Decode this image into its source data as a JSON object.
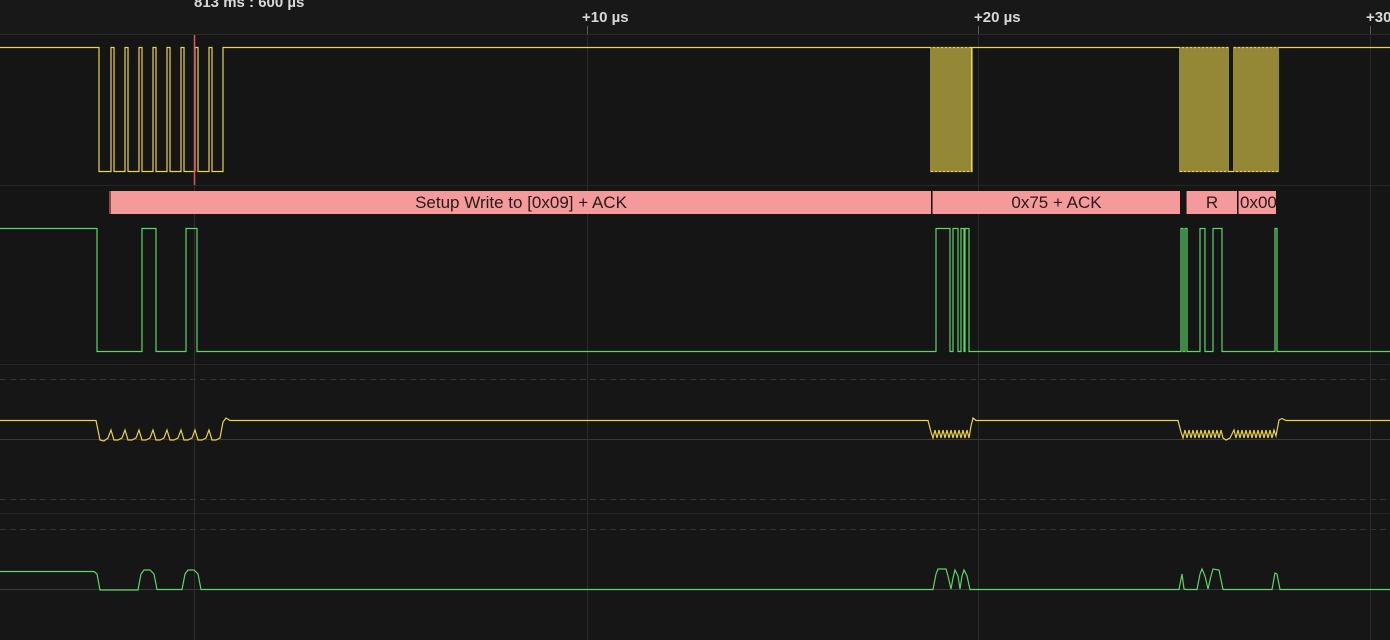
{
  "ruler": {
    "cursor_label": "813 ms : 600 µs",
    "ticks": [
      "+10 µs",
      "+20 µs",
      "+30"
    ]
  },
  "protocol": {
    "frames": [
      {
        "label": "Setup Write to [0x09] + ACK"
      },
      {
        "label": "0x75 + ACK"
      },
      {
        "label": "R"
      },
      {
        "label": "0x00"
      }
    ]
  },
  "colors": {
    "background": "#141414",
    "digital_channel_1": "#e8d44d",
    "digital_channel_2": "#5ed46a",
    "analyzer_frame": "#f49a9a",
    "cursor": "#d45a6a",
    "grid": "#2b2b2b"
  }
}
